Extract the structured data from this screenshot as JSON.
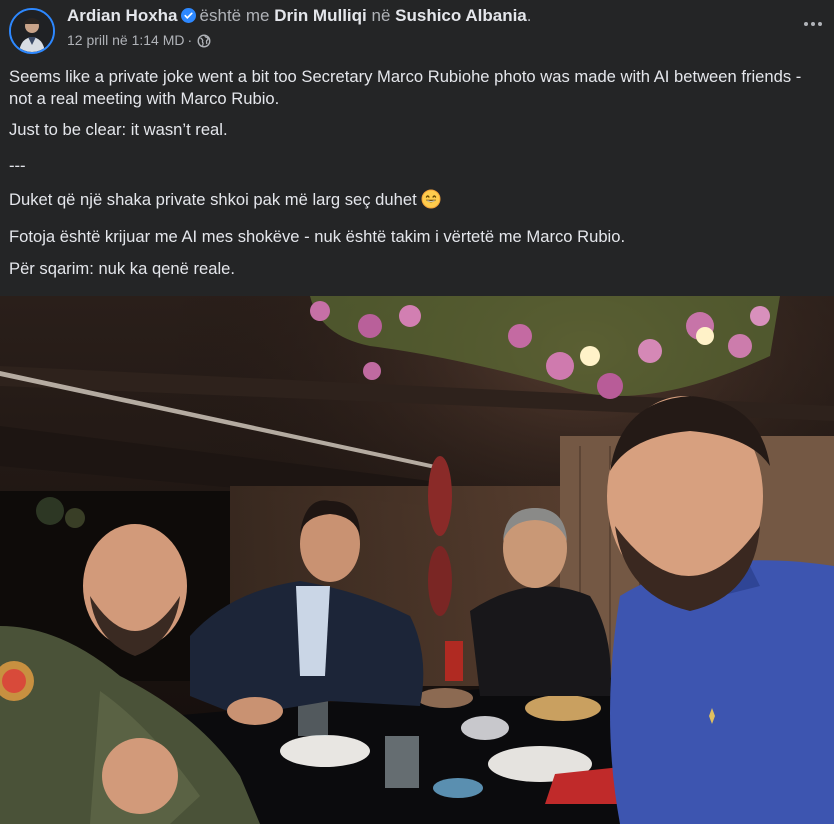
{
  "header": {
    "author": "Ardian Hoxha",
    "verified_icon": "verified-badge-icon",
    "is_with": "është me",
    "tagged_person": "Drin Mulliqi",
    "at": "në",
    "location": "Sushico Albania",
    "period": ".",
    "timestamp": "12 prill në 1:14 MD",
    "separator": "·",
    "audience_icon": "globe-icon",
    "more_icon": "more-options-icon"
  },
  "post": {
    "paragraphs": [
      "Seems like a private joke went a bit too Secretary Marco Rubiohe photo was made with AI between friends - not a real meeting with Marco Rubio.",
      "Just to be clear: it wasn’t real.",
      "---",
      "Duket që një shaka private shkoi pak më larg seç duhet",
      "Fotoja është krijuar me AI mes shokëve - nuk është takim i vërtetë me Marco Rubio.",
      "Për sqarim: nuk ka qenë reale."
    ],
    "emoji": "grinning-face-emoji"
  },
  "photo": {
    "alt_icon": "group-dinner-photo"
  },
  "colors": {
    "background": "#242526",
    "text": "#e4e6eb",
    "secondary_text": "#b0b3b8",
    "accent": "#2d88ff"
  }
}
